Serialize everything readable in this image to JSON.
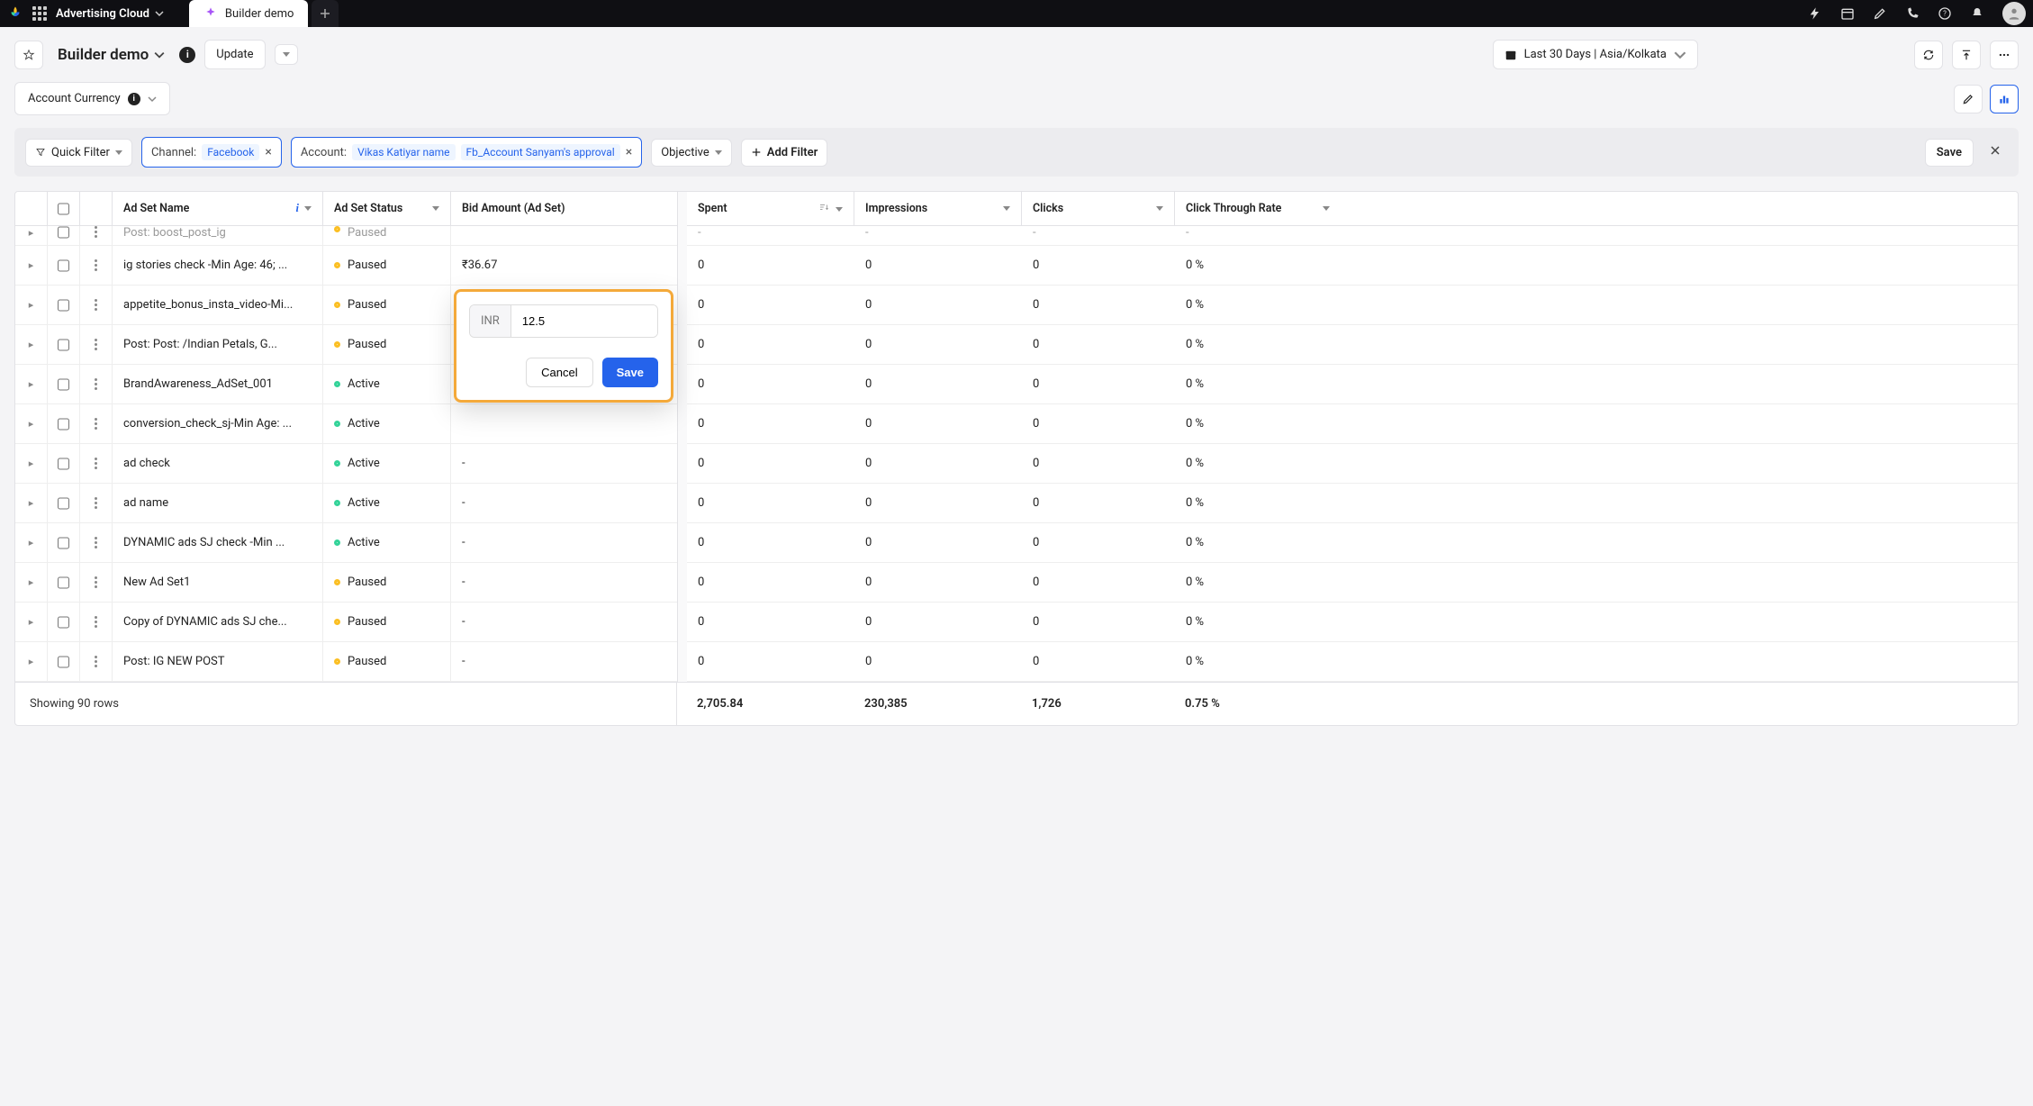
{
  "topbar": {
    "product": "Advertising Cloud",
    "tab_label": "Builder demo"
  },
  "toolbar": {
    "title": "Builder demo",
    "update": "Update",
    "date_range": "Last 30 Days | Asia/Kolkata",
    "currency_label": "Account Currency"
  },
  "filters": {
    "quick": "Quick Filter",
    "channel_label": "Channel:",
    "channel_val": "Facebook",
    "account_label": "Account:",
    "account_val1": "Vikas Katiyar name",
    "account_val2": "Fb_Account Sanyam's approval",
    "objective": "Objective",
    "add": "Add Filter",
    "save": "Save"
  },
  "columns": {
    "name": "Ad Set Name",
    "status": "Ad Set Status",
    "bid": "Bid Amount (Ad Set)",
    "spent": "Spent",
    "impr": "Impressions",
    "clicks": "Clicks",
    "ctr": "Click Through Rate"
  },
  "rows": [
    {
      "name": "Post: boost_post_ig",
      "status": "Paused",
      "statusType": "paused",
      "bid": "",
      "spent": "-",
      "impr": "-",
      "clicks": "-",
      "ctr": "-",
      "partial": true
    },
    {
      "name": "ig stories check -Min Age: 46; ...",
      "status": "Paused",
      "statusType": "paused",
      "bid": "₹36.67",
      "spent": "0",
      "impr": "0",
      "clicks": "0",
      "ctr": "0 %"
    },
    {
      "name": "appetite_bonus_insta_video-Mi...",
      "status": "Paused",
      "statusType": "paused",
      "bid": "₹12.50",
      "spent": "0",
      "impr": "0",
      "clicks": "0",
      "ctr": "0 %",
      "editable": true
    },
    {
      "name": "Post: Post: /Indian Petals, G...",
      "status": "Paused",
      "statusType": "paused",
      "bid": "",
      "spent": "0",
      "impr": "0",
      "clicks": "0",
      "ctr": "0 %"
    },
    {
      "name": "BrandAwareness_AdSet_001",
      "status": "Active",
      "statusType": "active",
      "bid": "",
      "spent": "0",
      "impr": "0",
      "clicks": "0",
      "ctr": "0 %"
    },
    {
      "name": "conversion_check_sj-Min Age: ...",
      "status": "Active",
      "statusType": "active",
      "bid": "",
      "spent": "0",
      "impr": "0",
      "clicks": "0",
      "ctr": "0 %"
    },
    {
      "name": "ad check",
      "status": "Active",
      "statusType": "active",
      "bid": "-",
      "spent": "0",
      "impr": "0",
      "clicks": "0",
      "ctr": "0 %"
    },
    {
      "name": "ad name",
      "status": "Active",
      "statusType": "active",
      "bid": "-",
      "spent": "0",
      "impr": "0",
      "clicks": "0",
      "ctr": "0 %"
    },
    {
      "name": "DYNAMIC ads SJ check -Min ...",
      "status": "Active",
      "statusType": "active",
      "bid": "-",
      "spent": "0",
      "impr": "0",
      "clicks": "0",
      "ctr": "0 %"
    },
    {
      "name": "New Ad Set1",
      "status": "Paused",
      "statusType": "paused",
      "bid": "-",
      "spent": "0",
      "impr": "0",
      "clicks": "0",
      "ctr": "0 %"
    },
    {
      "name": "Copy of DYNAMIC ads SJ che...",
      "status": "Paused",
      "statusType": "paused",
      "bid": "-",
      "spent": "0",
      "impr": "0",
      "clicks": "0",
      "ctr": "0 %"
    },
    {
      "name": "Post: IG NEW POST",
      "status": "Paused",
      "statusType": "paused",
      "bid": "-",
      "spent": "0",
      "impr": "0",
      "clicks": "0",
      "ctr": "0 %"
    }
  ],
  "editor": {
    "currency": "INR",
    "value": "12.5",
    "cancel": "Cancel",
    "save": "Save"
  },
  "footer": {
    "rows_text": "Showing 90 rows",
    "spent": "2,705.84",
    "impr": "230,385",
    "clicks": "1,726",
    "ctr": "0.75 %"
  }
}
